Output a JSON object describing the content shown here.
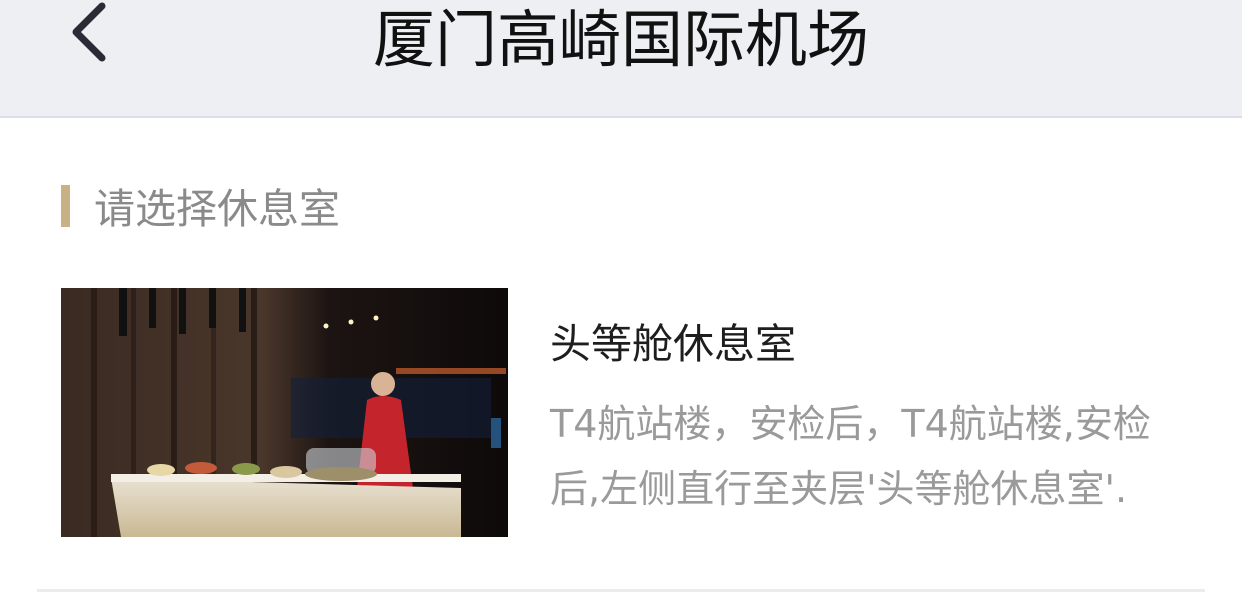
{
  "nav": {
    "title": "厦门高崎国际机场",
    "back_icon": "chevron-left-icon"
  },
  "section": {
    "title": "请选择休息室",
    "accent_color": "#c9b186"
  },
  "lounges": [
    {
      "name": "头等舱休息室",
      "description": "T4航站楼，安检后，T4航站楼,安检后,左侧直行至夹层'头等舱休息室'.",
      "photo": "lounge-photo"
    }
  ]
}
